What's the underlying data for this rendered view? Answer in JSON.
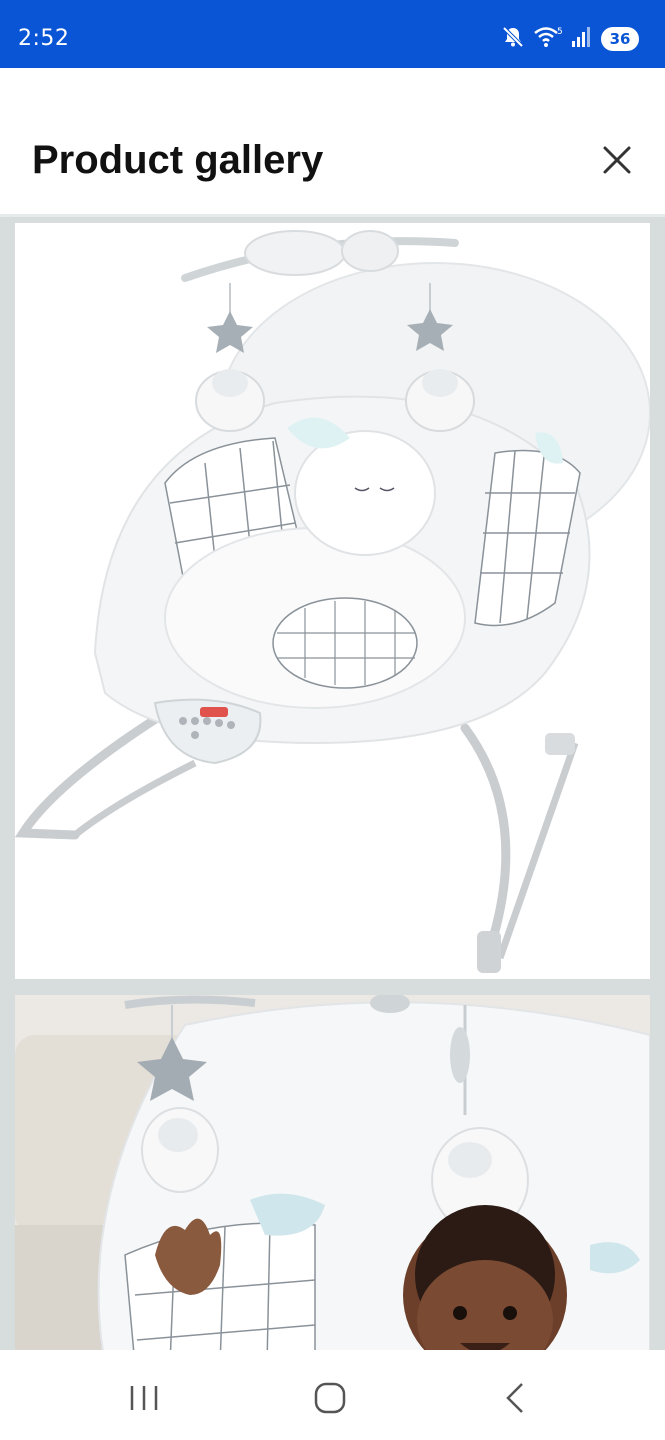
{
  "status_bar": {
    "time": "2:52",
    "battery": "36",
    "icons": [
      "mute-icon",
      "wifi-icon",
      "signal-icon",
      "battery-icon"
    ]
  },
  "header": {
    "title": "Product gallery",
    "close_icon": "close-icon"
  },
  "gallery": {
    "images": [
      {
        "name": "product-image-bouncer"
      },
      {
        "name": "product-image-baby-in-bouncer"
      }
    ]
  },
  "nav_bar": {
    "icons": [
      "recent-apps-icon",
      "home-icon",
      "back-icon"
    ]
  },
  "colors": {
    "status_bar": "#0a55d6",
    "gallery_bg": "#d7dcdd"
  }
}
